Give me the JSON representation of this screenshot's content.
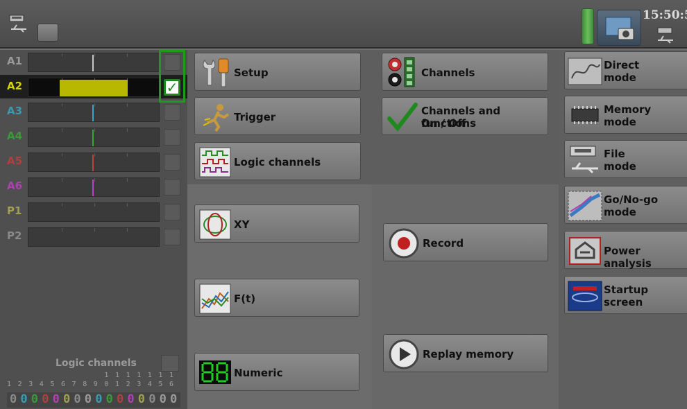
{
  "topbar": {
    "clock": "15:50:5"
  },
  "channels": [
    {
      "name": "A1",
      "color": "#9a9a9a",
      "mark": "#c8c8c8",
      "selected": false
    },
    {
      "name": "A2",
      "color": "#d4d400",
      "mark": "",
      "selected": true,
      "check": "✓"
    },
    {
      "name": "A3",
      "color": "#3a9ab0",
      "mark": "#3aa6c0",
      "selected": false
    },
    {
      "name": "A4",
      "color": "#3a9a3a",
      "mark": "#3aa63a",
      "selected": false
    },
    {
      "name": "A5",
      "color": "#b04040",
      "mark": "#c04040",
      "selected": false
    },
    {
      "name": "A6",
      "color": "#b040b0",
      "mark": "#c040c0",
      "selected": false
    },
    {
      "name": "P1",
      "color": "#a0a050",
      "mark": "",
      "selected": false
    },
    {
      "name": "P2",
      "color": "#8a8a8a",
      "mark": "",
      "selected": false
    }
  ],
  "logic": {
    "label": "Logic channels",
    "numbers_top": [
      "1",
      "1",
      "1",
      "1",
      "1",
      "1",
      "1"
    ],
    "numbers_bottom": [
      "1",
      "2",
      "3",
      "4",
      "5",
      "6",
      "7",
      "8",
      "9",
      "0",
      "1",
      "2",
      "3",
      "4",
      "5",
      "6"
    ],
    "bits": [
      "0",
      "0",
      "0",
      "0",
      "0",
      "0",
      "0",
      "0",
      "0",
      "0",
      "0",
      "0",
      "0",
      "0",
      "0",
      "0"
    ],
    "bit_colors": [
      "#8a8a8a",
      "#3a9ab0",
      "#3a9a3a",
      "#b04040",
      "#b040b0",
      "#a0a050",
      "#8a8a8a",
      "#9a9a9a",
      "#3a9ab0",
      "#3a9a3a",
      "#b04040",
      "#b040b0",
      "#a0a050",
      "#8a8a8a",
      "#9a9a9a",
      "#9a9a9a"
    ]
  },
  "buttons": {
    "setup": "Setup",
    "trigger": "Trigger",
    "logic_channels": "Logic channels",
    "channels": "Channels",
    "channels_functions_1": "Channels and functions",
    "channels_functions_2": "On / Off",
    "xy": "XY",
    "ft": "F(t)",
    "numeric": "Numeric",
    "record": "Record",
    "replay": "Replay memory"
  },
  "modes": {
    "direct_1": "Direct",
    "direct_2": "mode",
    "memory_1": "Memory",
    "memory_2": "mode",
    "file_1": "File",
    "file_2": "mode",
    "gonogo_1": "Go/No-go",
    "gonogo_2": "mode",
    "power": "Power analysis",
    "startup_1": "Startup",
    "startup_2": "screen"
  },
  "colors": {
    "selected_check": "#1e9a1e",
    "a2_fill": "#b8b800",
    "numeric_led": "#22cc22"
  }
}
